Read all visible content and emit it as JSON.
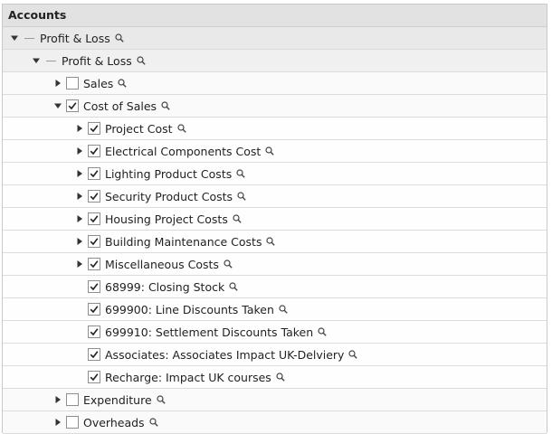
{
  "header": {
    "title": "Accounts"
  },
  "tree": [
    {
      "label": "Profit & Loss",
      "level": 0,
      "state": "expanded",
      "check": "dash"
    },
    {
      "label": "Profit & Loss",
      "level": 1,
      "state": "expanded",
      "check": "dash"
    },
    {
      "label": "Sales",
      "level": 2,
      "state": "collapsed",
      "check": "unchecked"
    },
    {
      "label": "Cost of Sales",
      "level": 2,
      "state": "expanded",
      "check": "checked"
    },
    {
      "label": "Project Cost",
      "level": 3,
      "state": "collapsed",
      "check": "checked"
    },
    {
      "label": "Electrical Components Cost",
      "level": 3,
      "state": "collapsed",
      "check": "checked"
    },
    {
      "label": "Lighting Product Costs",
      "level": 3,
      "state": "collapsed",
      "check": "checked"
    },
    {
      "label": "Security Product Costs",
      "level": 3,
      "state": "collapsed",
      "check": "checked"
    },
    {
      "label": "Housing Project Costs",
      "level": 3,
      "state": "collapsed",
      "check": "checked"
    },
    {
      "label": "Building Maintenance Costs",
      "level": 3,
      "state": "collapsed",
      "check": "checked"
    },
    {
      "label": "Miscellaneous Costs",
      "level": 3,
      "state": "collapsed",
      "check": "checked"
    },
    {
      "label": "68999: Closing Stock",
      "level": 3,
      "state": "leaf",
      "check": "checked"
    },
    {
      "label": "699900: Line Discounts Taken",
      "level": 3,
      "state": "leaf",
      "check": "checked"
    },
    {
      "label": "699910: Settlement Discounts Taken",
      "level": 3,
      "state": "leaf",
      "check": "checked"
    },
    {
      "label": "Associates: Associates Impact UK-Delviery",
      "level": 3,
      "state": "leaf",
      "check": "checked"
    },
    {
      "label": "Recharge: Impact UK courses",
      "level": 3,
      "state": "leaf",
      "check": "checked"
    },
    {
      "label": "Expenditure",
      "level": 2,
      "state": "collapsed",
      "check": "unchecked"
    },
    {
      "label": "Overheads",
      "level": 2,
      "state": "collapsed",
      "check": "unchecked"
    }
  ]
}
